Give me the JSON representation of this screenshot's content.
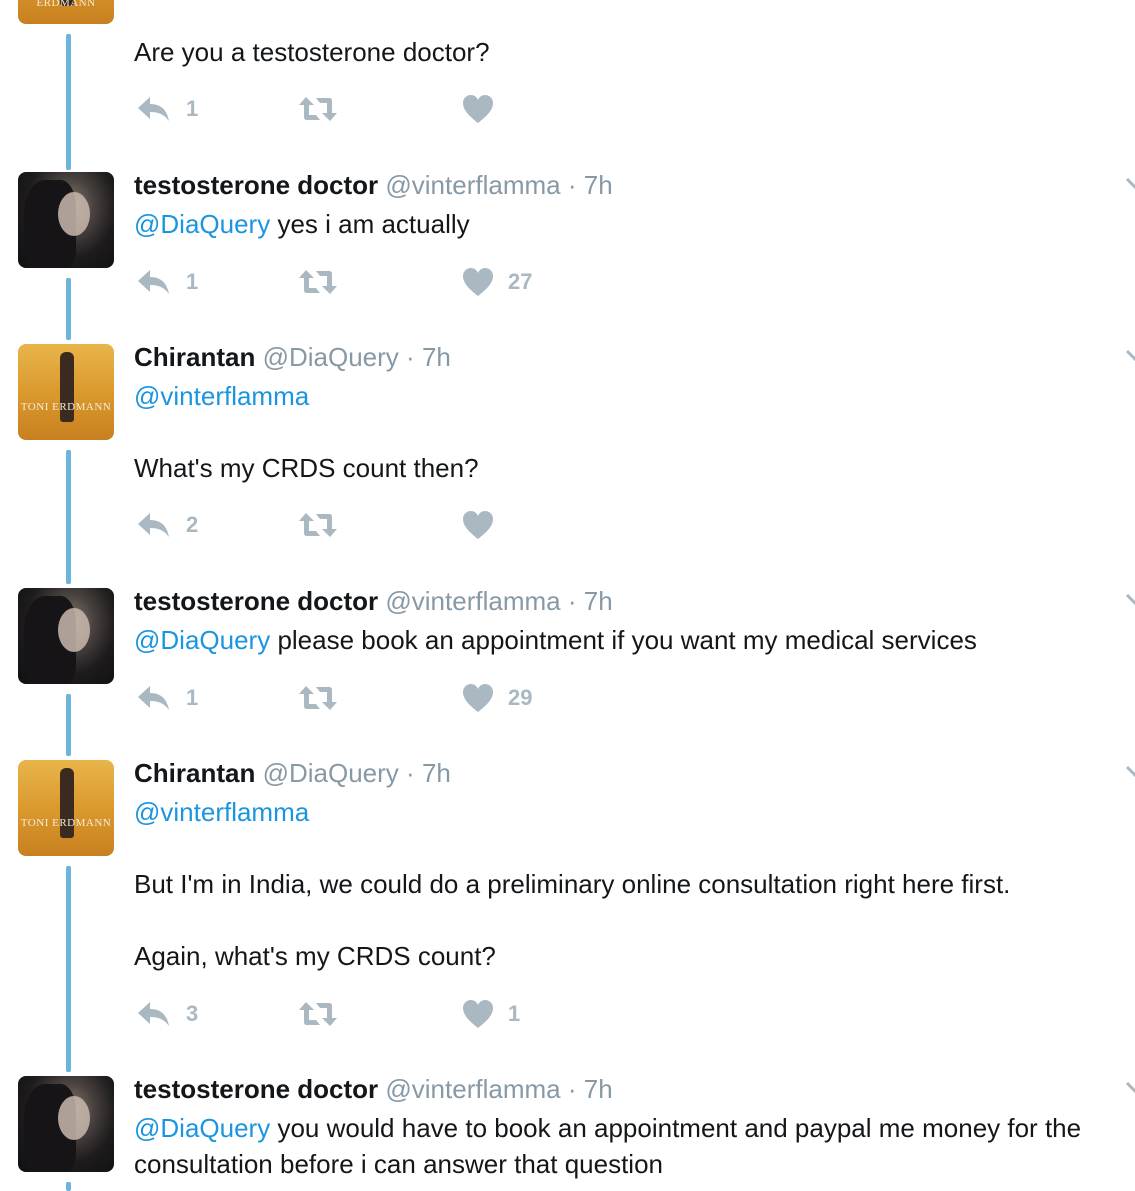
{
  "tweets": [
    {
      "avatar": "poster",
      "avatar_caption": "ERDMANN",
      "display_name": "",
      "handle": "",
      "time": "",
      "paragraphs": [
        [
          {
            "text": "Are you a testosterone doctor?"
          }
        ]
      ],
      "replies": "1",
      "retweets": "",
      "likes": ""
    },
    {
      "avatar": "girl",
      "display_name": "testosterone doctor",
      "handle": "@vinterflamma",
      "dot": "·",
      "time": "7h",
      "paragraphs": [
        [
          {
            "mention": "@DiaQuery"
          },
          {
            "text": " yes i am actually"
          }
        ]
      ],
      "replies": "1",
      "retweets": "",
      "likes": "27"
    },
    {
      "avatar": "poster",
      "avatar_caption": "TONI ERDMANN",
      "display_name": "Chirantan",
      "handle": "@DiaQuery",
      "dot": "·",
      "time": "7h",
      "paragraphs": [
        [
          {
            "mention": "@vinterflamma"
          }
        ],
        [
          {
            "text": "What's my CRDS count then?"
          }
        ]
      ],
      "replies": "2",
      "retweets": "",
      "likes": ""
    },
    {
      "avatar": "girl",
      "display_name": "testosterone doctor",
      "handle": "@vinterflamma",
      "dot": "·",
      "time": "7h",
      "paragraphs": [
        [
          {
            "mention": "@DiaQuery"
          },
          {
            "text": " please book an appointment if you want my medical services"
          }
        ]
      ],
      "replies": "1",
      "retweets": "",
      "likes": "29"
    },
    {
      "avatar": "poster",
      "avatar_caption": "TONI ERDMANN",
      "display_name": "Chirantan",
      "handle": "@DiaQuery",
      "dot": "·",
      "time": "7h",
      "paragraphs": [
        [
          {
            "mention": "@vinterflamma"
          }
        ],
        [
          {
            "text": "But I'm in India, we could do a preliminary online consultation right here first."
          }
        ],
        [
          {
            "text": "Again, what's my CRDS count?"
          }
        ]
      ],
      "replies": "3",
      "retweets": "",
      "likes": "1"
    },
    {
      "avatar": "girl",
      "display_name": "testosterone doctor",
      "handle": "@vinterflamma",
      "dot": "·",
      "time": "7h",
      "paragraphs": [
        [
          {
            "mention": "@DiaQuery"
          },
          {
            "text": " you would have to book an appointment and paypal me money for the consultation before i can answer that question"
          }
        ]
      ],
      "replies": "",
      "retweets": "",
      "likes": ""
    }
  ],
  "icons": {
    "reply": "reply-icon",
    "retweet": "retweet-icon",
    "like": "heart-icon",
    "more": "chevron-down-icon"
  },
  "colors": {
    "thread_line": "#6cb4da",
    "mention": "#1b95e0",
    "meta_gray": "#8899a6",
    "action_gray": "#aab8c2"
  }
}
